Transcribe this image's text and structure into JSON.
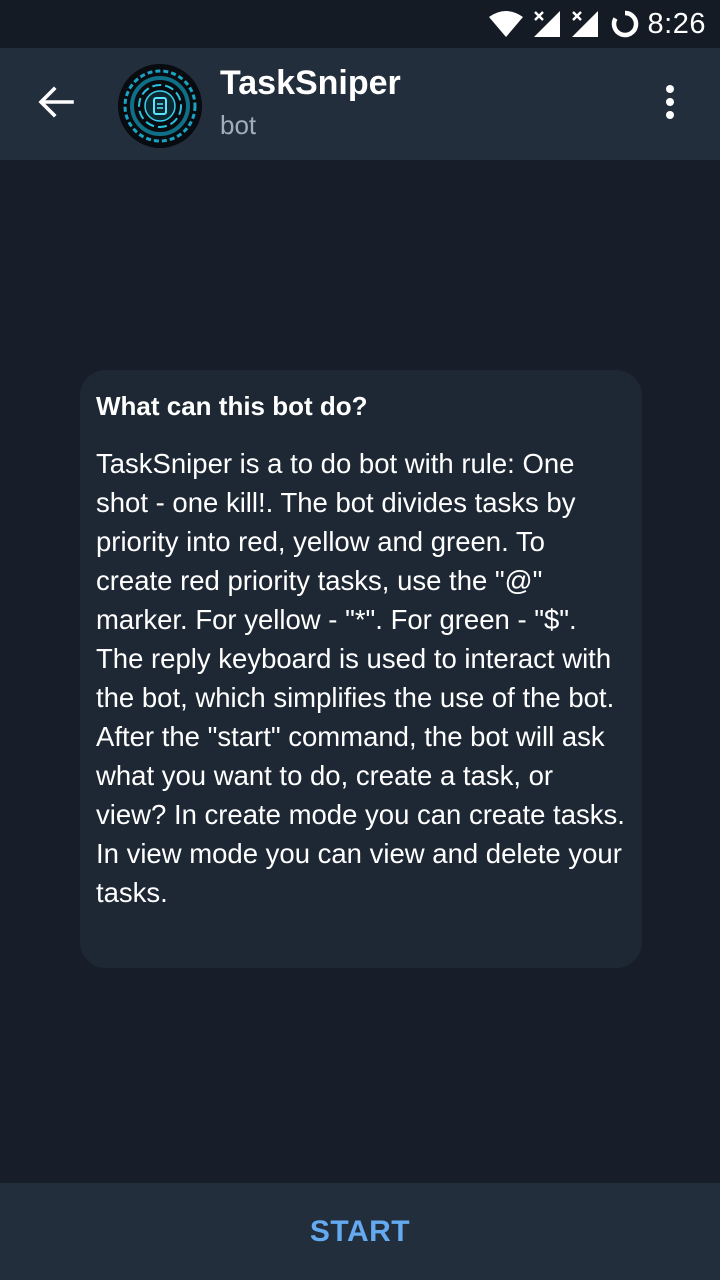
{
  "status_bar": {
    "time": "8:26",
    "icons": [
      "wifi-icon",
      "signal-no-data-icon",
      "signal-no-data-icon",
      "loading-ring-icon"
    ]
  },
  "header": {
    "back_icon": "arrow-left-icon",
    "title": "TaskSniper",
    "subtitle": "bot",
    "menu_icon": "more-vertical-icon"
  },
  "info": {
    "title": "What can this bot do?",
    "description": "TaskSniper is a to do bot with rule: One shot - one kill!. The bot divides tasks by priority into red, yellow and green. To create red priority tasks, use the \"@\" marker. For yellow - \"*\". For green - \"$\". The reply keyboard is used to interact with the bot, which simplifies the use of the bot.\nAfter the \"start\" command, the bot will ask what you want to do, create a task, or view? In create mode you can create tasks. In view mode you can view and delete your tasks."
  },
  "footer": {
    "start_label": "START"
  },
  "colors": {
    "background": "#171e29",
    "header": "#232e3c",
    "card": "#1e2834",
    "accent": "#64aaf0",
    "subtitle": "#a2adb9"
  }
}
